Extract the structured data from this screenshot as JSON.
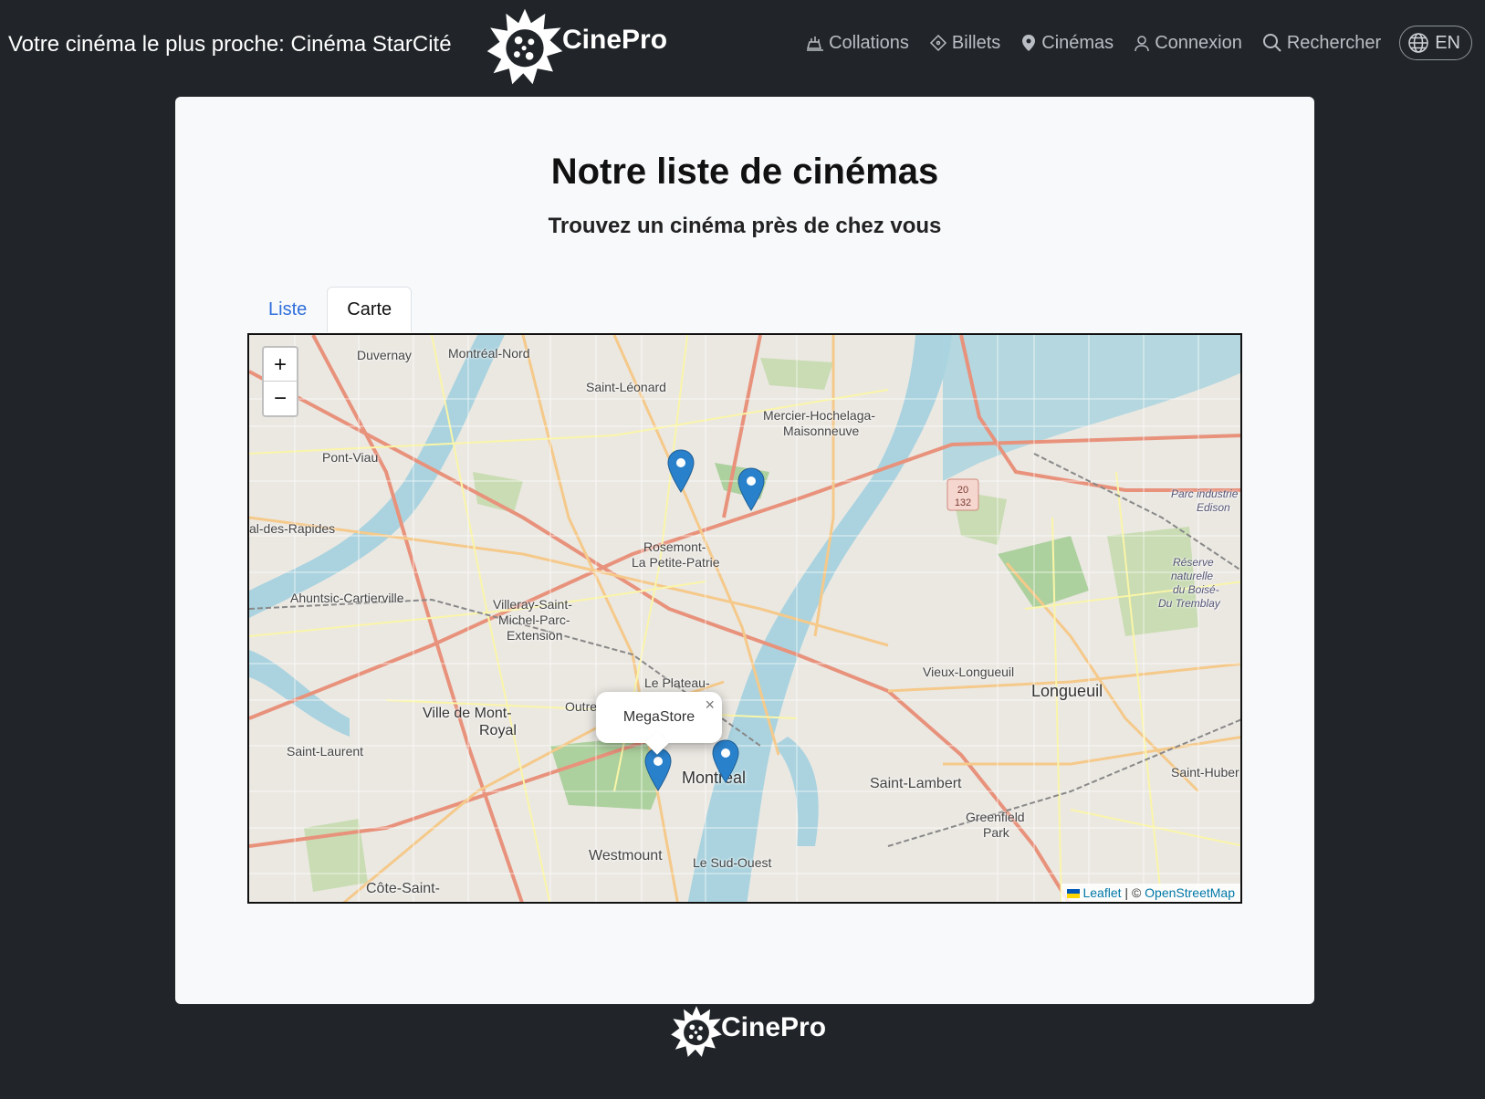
{
  "header": {
    "nearest_cinema": "Votre cinéma le plus proche: Cinéma StarCité",
    "brand": "CinePro",
    "nav": {
      "snacks": "Collations",
      "tickets": "Billets",
      "cinemas": "Cinémas",
      "login": "Connexion",
      "search": "Rechercher",
      "language": "EN"
    }
  },
  "main": {
    "title": "Notre liste de cinémas",
    "subtitle": "Trouvez un cinéma près de chez vous",
    "tabs": {
      "list": "Liste",
      "map": "Carte"
    },
    "active_tab": "Carte"
  },
  "map": {
    "zoom_in": "+",
    "zoom_out": "−",
    "popup": {
      "text": "MegaStore",
      "close": "×"
    },
    "labels": {
      "duvernay": "Duvernay",
      "montreal_nord": "Montréal-Nord",
      "saint_leonard": "Saint-Léonard",
      "mercier": "Mercier-Hochelaga-",
      "maisonneuve": "Maisonneuve",
      "pont_viau": "Pont-Viau",
      "rapides": "al-des-Rapides",
      "rosemont1": "Rosemont-",
      "rosemont2": "La Petite-Patrie",
      "ahuntsic": "Ahuntsic-Cartierville",
      "villeray1": "Villeray-Saint-",
      "villeray2": "Michel-Parc-",
      "villeray3": "Extension",
      "plateau": "Le Plateau-",
      "outre": "Outre",
      "mont_royal1": "Ville de Mont-",
      "mont_royal2": "Royal",
      "saint_laurent": "Saint-Laurent",
      "montreal": "Montréal",
      "vieux_longueuil": "Vieux-Longueuil",
      "longueuil": "Longueuil",
      "saint_lambert": "Saint-Lambert",
      "greenfield1": "Greenfield",
      "greenfield2": "Park",
      "westmount": "Westmount",
      "sud_ouest": "Le Sud-Ouest",
      "cote_saint": "Côte-Saint-",
      "saint_hubert": "Saint-Huber",
      "parc_ind1": "Parc industrie",
      "parc_ind2": "Edison",
      "reserve1": "Réserve",
      "reserve2": "naturelle",
      "reserve3": "du Boisé-",
      "reserve4": "Du Tremblay"
    },
    "attribution": {
      "leaflet": "Leaflet",
      "separator": " | © ",
      "osm": "OpenStreetMap"
    },
    "marker_color": "#2a81cb"
  },
  "footer": {
    "brand": "CinePro"
  },
  "colors": {
    "background": "#212529",
    "card": "#f8f9fa",
    "link": "#2f6fdc",
    "river": "#aad3df"
  }
}
